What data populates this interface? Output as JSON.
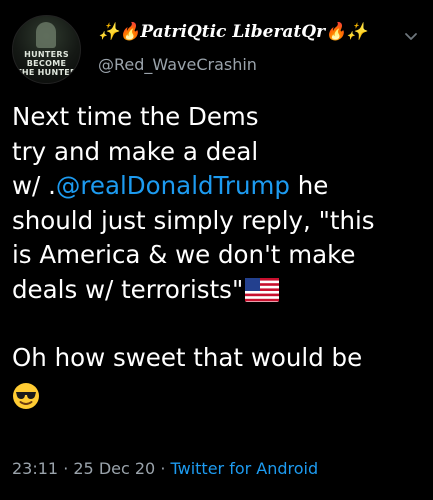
{
  "author": {
    "display_name": "✨🔥PatriQtic LiberatQr🔥✨",
    "handle": "@Red_WaveCrashin",
    "avatar_text": [
      "HUNTERS",
      "BECOME",
      "THE HUNTED"
    ]
  },
  "tweet": {
    "line1": "Next time the Dems",
    "line2": "try and make a deal",
    "line3_prefix": "w/ .",
    "mention": "@realDonaldTrump",
    "line3_suffix": " he",
    "line4": "should just simply reply, \"this",
    "line5": "is America & we don't make",
    "line6": "deals w/ terrorists\"",
    "line7": "Oh how sweet that would be"
  },
  "meta": {
    "time": "23:11",
    "sep1": " · ",
    "date": "25 Dec 20",
    "sep2": " · ",
    "source": "Twitter for Android"
  },
  "icons": {
    "flag": "us-flag-icon",
    "emoji": "sunglasses-emoji-icon",
    "menu": "chevron-down-icon"
  },
  "colors": {
    "background": "#000000",
    "text": "#ffffff",
    "secondary": "#9aa3ab",
    "link": "#1d9bf0"
  }
}
